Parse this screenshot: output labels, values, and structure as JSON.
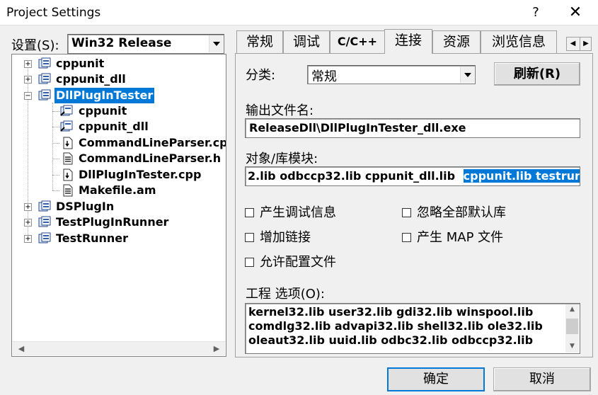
{
  "window": {
    "title": "Project Settings",
    "help_glyph": "?",
    "close_glyph": "✕"
  },
  "settings": {
    "label": "设置(S):",
    "config_value": "Win32 Release"
  },
  "tree": {
    "items": [
      {
        "label": "cppunit"
      },
      {
        "label": "cppunit_dll"
      },
      {
        "label": "DllPlugInTester"
      },
      {
        "label": "cppunit"
      },
      {
        "label": "cppunit_dll"
      },
      {
        "label": "CommandLineParser.cpp"
      },
      {
        "label": "CommandLineParser.h"
      },
      {
        "label": "DllPlugInTester.cpp"
      },
      {
        "label": "Makefile.am"
      },
      {
        "label": "DSPlugIn"
      },
      {
        "label": "TestPlugInRunner"
      },
      {
        "label": "TestRunner"
      }
    ],
    "expand_plus": "+",
    "expand_minus": "−"
  },
  "tabs": [
    "常规",
    "调试",
    "C/C++",
    "连接",
    "资源",
    "浏览信息"
  ],
  "active_tab": "连接",
  "link": {
    "category_label": "分类:",
    "category_value": "常规",
    "reset_button": "刷新(R)",
    "output_label": "输出文件名:",
    "output_value": "ReleaseDll\\DllPlugInTester_dll.exe",
    "modules_label": "对象/库模块:",
    "modules_value_plain": "2.lib odbccp32.lib cppunit_dll.lib ",
    "modules_value_selected": "cppunit.lib testrunner.lib",
    "checkboxes": [
      {
        "label": "产生调试信息",
        "checked": false
      },
      {
        "label": "忽略全部默认库",
        "checked": false
      },
      {
        "label": "增加链接",
        "checked": false
      },
      {
        "label": "产生 MAP 文件",
        "checked": false
      },
      {
        "label": "允许配置文件",
        "checked": false
      }
    ],
    "options_label": "工程 选项(O):",
    "options_lines": [
      "kernel32.lib user32.lib gdi32.lib winspool.lib",
      "comdlg32.lib advapi32.lib shell32.lib ole32.lib",
      "oleaut32.lib uuid.lib odbc32.lib odbccp32.lib"
    ]
  },
  "buttons": {
    "ok": "确定",
    "cancel": "取消"
  },
  "colors": {
    "selection": "#0078d7",
    "face": "#f0f0f0"
  }
}
